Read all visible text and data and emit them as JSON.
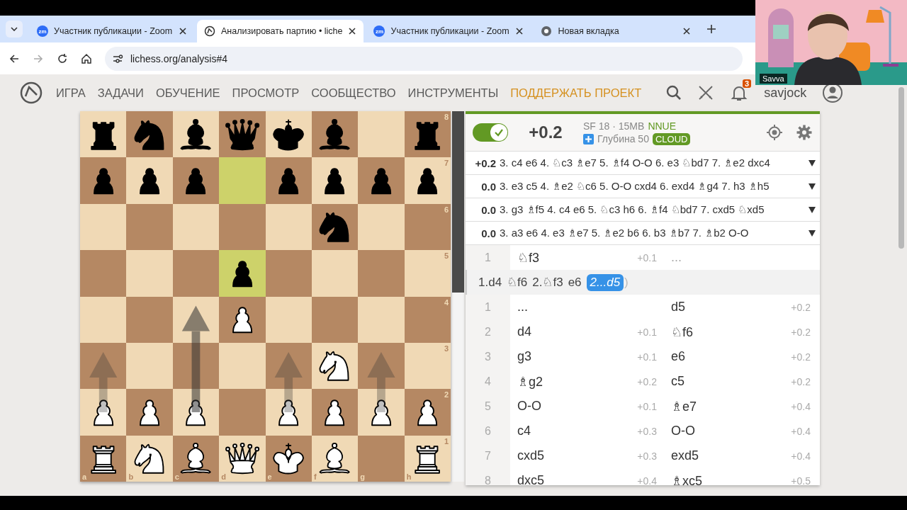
{
  "browser": {
    "tabs": [
      {
        "kind": "zoom",
        "icon_text": "zm",
        "title": "Участник публикации - Zoom",
        "selected": false
      },
      {
        "kind": "lichess",
        "title": "Анализировать партию • liche",
        "selected": true
      },
      {
        "kind": "zoom",
        "icon_text": "zm",
        "title": "Участник публикации - Zoom",
        "selected": false
      },
      {
        "kind": "chrome",
        "title": "Новая вкладка",
        "selected": false
      }
    ],
    "url": "lichess.org/analysis#4"
  },
  "video": {
    "participant": "Savva"
  },
  "nav": {
    "items": [
      {
        "label": "ИГРА",
        "kind": "normal"
      },
      {
        "label": "ЗАДАЧИ",
        "kind": "normal"
      },
      {
        "label": "ОБУЧЕНИЕ",
        "kind": "normal"
      },
      {
        "label": "ПРОСМОТР",
        "kind": "normal"
      },
      {
        "label": "СООБЩЕСТВО",
        "kind": "normal"
      },
      {
        "label": "ИНСТРУМЕНТЫ",
        "kind": "normal"
      },
      {
        "label": "ПОДДЕРЖАТЬ ПРОЕКТ",
        "kind": "highlight"
      }
    ],
    "notifications": "3",
    "username": "savjock"
  },
  "board": {
    "files": [
      "a",
      "b",
      "c",
      "d",
      "e",
      "f",
      "g",
      "h"
    ],
    "ranks": [
      {
        "label": "8",
        "squares": [
          {
            "kind": "black-rook",
            "highlight": false
          },
          {
            "kind": "black-knight",
            "highlight": false
          },
          {
            "kind": "black-bishop",
            "highlight": false
          },
          {
            "kind": "black-queen",
            "highlight": false
          },
          {
            "kind": "black-king",
            "highlight": false
          },
          {
            "kind": "black-bishop",
            "highlight": false
          },
          {
            "kind": "empty",
            "highlight": false
          },
          {
            "kind": "black-rook",
            "highlight": false
          }
        ]
      },
      {
        "label": "7",
        "squares": [
          {
            "kind": "black-pawn",
            "highlight": false
          },
          {
            "kind": "black-pawn",
            "highlight": false
          },
          {
            "kind": "black-pawn",
            "highlight": false
          },
          {
            "kind": "empty",
            "highlight": true
          },
          {
            "kind": "black-pawn",
            "highlight": false
          },
          {
            "kind": "black-pawn",
            "highlight": false
          },
          {
            "kind": "black-pawn",
            "highlight": false
          },
          {
            "kind": "black-pawn",
            "highlight": false
          }
        ]
      },
      {
        "label": "6",
        "squares": [
          {
            "kind": "empty",
            "highlight": false
          },
          {
            "kind": "empty",
            "highlight": false
          },
          {
            "kind": "empty",
            "highlight": false
          },
          {
            "kind": "empty",
            "highlight": false
          },
          {
            "kind": "empty",
            "highlight": false
          },
          {
            "kind": "black-knight",
            "highlight": false
          },
          {
            "kind": "empty",
            "highlight": false
          },
          {
            "kind": "empty",
            "highlight": false
          }
        ]
      },
      {
        "label": "5",
        "squares": [
          {
            "kind": "empty",
            "highlight": false
          },
          {
            "kind": "empty",
            "highlight": false
          },
          {
            "kind": "empty",
            "highlight": false
          },
          {
            "kind": "black-pawn",
            "highlight": true
          },
          {
            "kind": "empty",
            "highlight": false
          },
          {
            "kind": "empty",
            "highlight": false
          },
          {
            "kind": "empty",
            "highlight": false
          },
          {
            "kind": "empty",
            "highlight": false
          }
        ]
      },
      {
        "label": "4",
        "squares": [
          {
            "kind": "empty",
            "highlight": false
          },
          {
            "kind": "empty",
            "highlight": false
          },
          {
            "kind": "empty",
            "highlight": false
          },
          {
            "kind": "white-pawn",
            "highlight": false
          },
          {
            "kind": "empty",
            "highlight": false
          },
          {
            "kind": "empty",
            "highlight": false
          },
          {
            "kind": "empty",
            "highlight": false
          },
          {
            "kind": "empty",
            "highlight": false
          }
        ]
      },
      {
        "label": "3",
        "squares": [
          {
            "kind": "empty",
            "highlight": false
          },
          {
            "kind": "empty",
            "highlight": false
          },
          {
            "kind": "empty",
            "highlight": false
          },
          {
            "kind": "empty",
            "highlight": false
          },
          {
            "kind": "empty",
            "highlight": false
          },
          {
            "kind": "white-knight",
            "highlight": false
          },
          {
            "kind": "empty",
            "highlight": false
          },
          {
            "kind": "empty",
            "highlight": false
          }
        ]
      },
      {
        "label": "2",
        "squares": [
          {
            "kind": "white-pawn",
            "highlight": false,
            "arrow": {
              "kind": "short",
              "strong": false
            }
          },
          {
            "kind": "white-pawn",
            "highlight": false
          },
          {
            "kind": "white-pawn",
            "highlight": false,
            "arrow": {
              "kind": "long",
              "strong": true
            }
          },
          {
            "kind": "empty",
            "highlight": false
          },
          {
            "kind": "white-pawn",
            "highlight": false,
            "arrow": {
              "kind": "short",
              "strong": false
            }
          },
          {
            "kind": "white-pawn",
            "highlight": false
          },
          {
            "kind": "white-pawn",
            "highlight": false,
            "arrow": {
              "kind": "short",
              "strong": false
            }
          },
          {
            "kind": "white-pawn",
            "highlight": false
          }
        ]
      },
      {
        "label": "1",
        "squares": [
          {
            "kind": "white-rook",
            "highlight": false
          },
          {
            "kind": "white-knight",
            "highlight": false
          },
          {
            "kind": "white-bishop",
            "highlight": false
          },
          {
            "kind": "white-queen",
            "highlight": false
          },
          {
            "kind": "white-king",
            "highlight": false
          },
          {
            "kind": "white-bishop",
            "highlight": false
          },
          {
            "kind": "empty",
            "highlight": false
          },
          {
            "kind": "white-rook",
            "highlight": false
          }
        ]
      }
    ]
  },
  "eval_gauge": {
    "level": 0.51
  },
  "ceval": {
    "enabled": true,
    "score": "+0.2",
    "engine": "SF 18 · 15MB",
    "engine_tag": "NNUE",
    "depth": "Глубина 50",
    "depth_tag": "CLOUD"
  },
  "pv_lines": [
    {
      "score": "+0.2",
      "moves": "3. c4 e6 4. ♘c3 ♗e7 5. ♗f4 O-O 6. e3 ♘bd7 7. ♗e2 dxc4"
    },
    {
      "score": "0.0",
      "moves": "3. e3 c5 4. ♗e2 ♘c6 5. O-O cxd4 6. exd4 ♗g4 7. h3 ♗h5"
    },
    {
      "score": "0.0",
      "moves": "3. g3 ♗f5 4. c4 e6 5. ♘c3 h6 6. ♗f4 ♘bd7 7. cxd5 ♘xd5"
    },
    {
      "score": "0.0",
      "moves": "3. a3 e6 4. e3 ♗e7 5. ♗e2 b6 6. b3 ♗b7 7. ♗b2 O-O"
    }
  ],
  "moves": {
    "top_row": {
      "index": "1",
      "white": "♘f3",
      "white_eval": "+0.1",
      "black": "..."
    },
    "variation": [
      {
        "text": "1.d4",
        "selected": false
      },
      {
        "text": "♘f6",
        "selected": false
      },
      {
        "text": "2.♘f3",
        "selected": false
      },
      {
        "text": "e6",
        "selected": false
      },
      {
        "text": "2...d5",
        "selected": true
      }
    ],
    "variation_end": ")",
    "rows": [
      {
        "index": "1",
        "white": "...",
        "black": "d5",
        "black_eval": "+0.2"
      },
      {
        "index": "2",
        "white": "d4",
        "white_eval": "+0.1",
        "black": "♘f6",
        "black_eval": "+0.2"
      },
      {
        "index": "3",
        "white": "g3",
        "white_eval": "+0.1",
        "black": "e6",
        "black_eval": "+0.2"
      },
      {
        "index": "4",
        "white": "♗g2",
        "white_eval": "+0.2",
        "black": "c5",
        "black_eval": "+0.2"
      },
      {
        "index": "5",
        "white": "O-O",
        "white_eval": "+0.1",
        "black": "♗e7",
        "black_eval": "+0.4"
      },
      {
        "index": "6",
        "white": "c4",
        "white_eval": "+0.3",
        "black": "O-O",
        "black_eval": "+0.4"
      },
      {
        "index": "7",
        "white": "cxd5",
        "white_eval": "+0.3",
        "black": "exd5",
        "black_eval": "+0.4"
      },
      {
        "index": "8",
        "white": "dxc5",
        "white_eval": "+0.4",
        "black": "♗xc5",
        "black_eval": "+0.5"
      }
    ]
  }
}
